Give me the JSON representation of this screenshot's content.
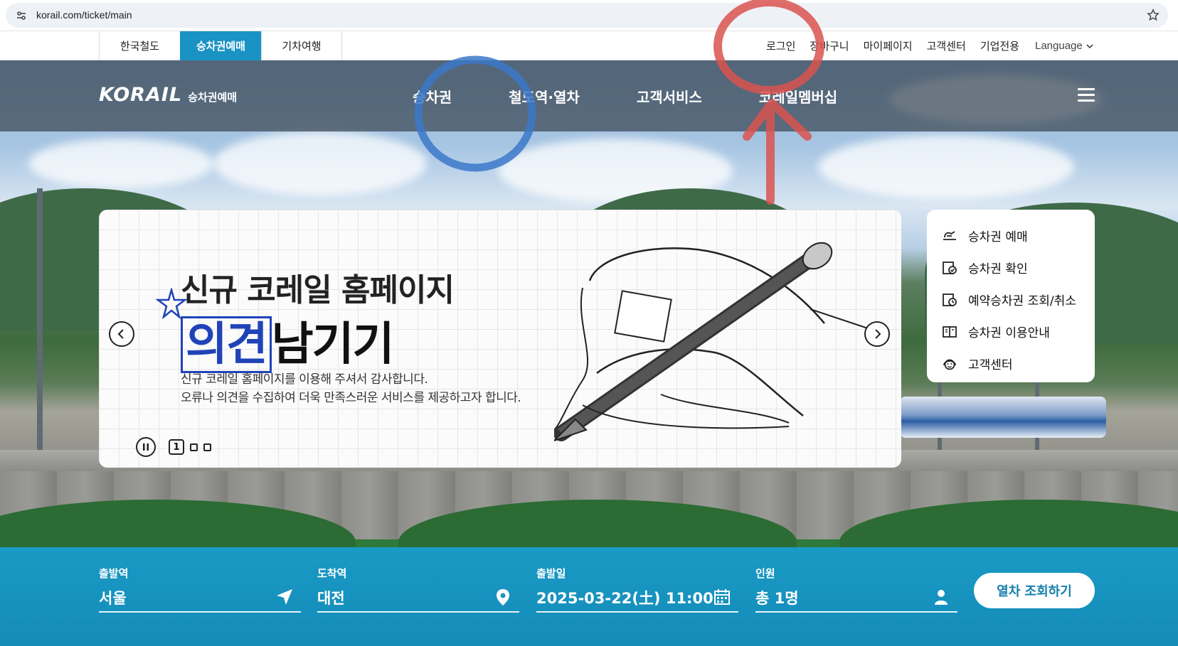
{
  "browser": {
    "url": "korail.com/ticket/main"
  },
  "site_tabs": [
    {
      "label": "한국철도"
    },
    {
      "label": "승차권예매"
    },
    {
      "label": "기차여행"
    }
  ],
  "util_links": [
    {
      "label": "로그인"
    },
    {
      "label": "장바구니"
    },
    {
      "label": "마이페이지"
    },
    {
      "label": "고객센터"
    },
    {
      "label": "기업전용"
    }
  ],
  "language": {
    "label": "Language"
  },
  "logo": {
    "main": "KORAIL",
    "sub": "승차권예매"
  },
  "nav": [
    {
      "label": "승차권"
    },
    {
      "label": "철도역·열차"
    },
    {
      "label": "고객서비스"
    },
    {
      "label": "코레일멤버십"
    }
  ],
  "banner": {
    "title_line1": "신규 코레일 홈페이지",
    "title_highlight": "의견",
    "title_rest": "남기기",
    "desc_line1": "신규 코레일 홈페이지를 이용해 주셔서 감사합니다.",
    "desc_line2": "오류나 의견을 수집하여 더욱 만족스러운 서비스를 제공하고자 합니다.",
    "current_page": "1"
  },
  "quick_menu": [
    {
      "label": "승차권 예매",
      "icon": "ticket-pen-icon"
    },
    {
      "label": "승차권 확인",
      "icon": "ticket-check-icon"
    },
    {
      "label": "예약승차권 조회/취소",
      "icon": "ticket-search-icon"
    },
    {
      "label": "승차권 이용안내",
      "icon": "book-icon"
    },
    {
      "label": "고객센터",
      "icon": "headset-icon"
    }
  ],
  "search": {
    "departure": {
      "label": "출발역",
      "value": "서울"
    },
    "arrival": {
      "label": "도착역",
      "value": "대전"
    },
    "date": {
      "label": "출발일",
      "value": "2025-03-22(土) 11:00"
    },
    "people": {
      "label": "인원",
      "value": "총 1명"
    },
    "button": "열차 조회하기"
  },
  "colors": {
    "accent": "#1a93c4",
    "search_bar": "#1a9ac6",
    "annotation_red": "#d9534f",
    "annotation_blue": "#3b78c9"
  }
}
